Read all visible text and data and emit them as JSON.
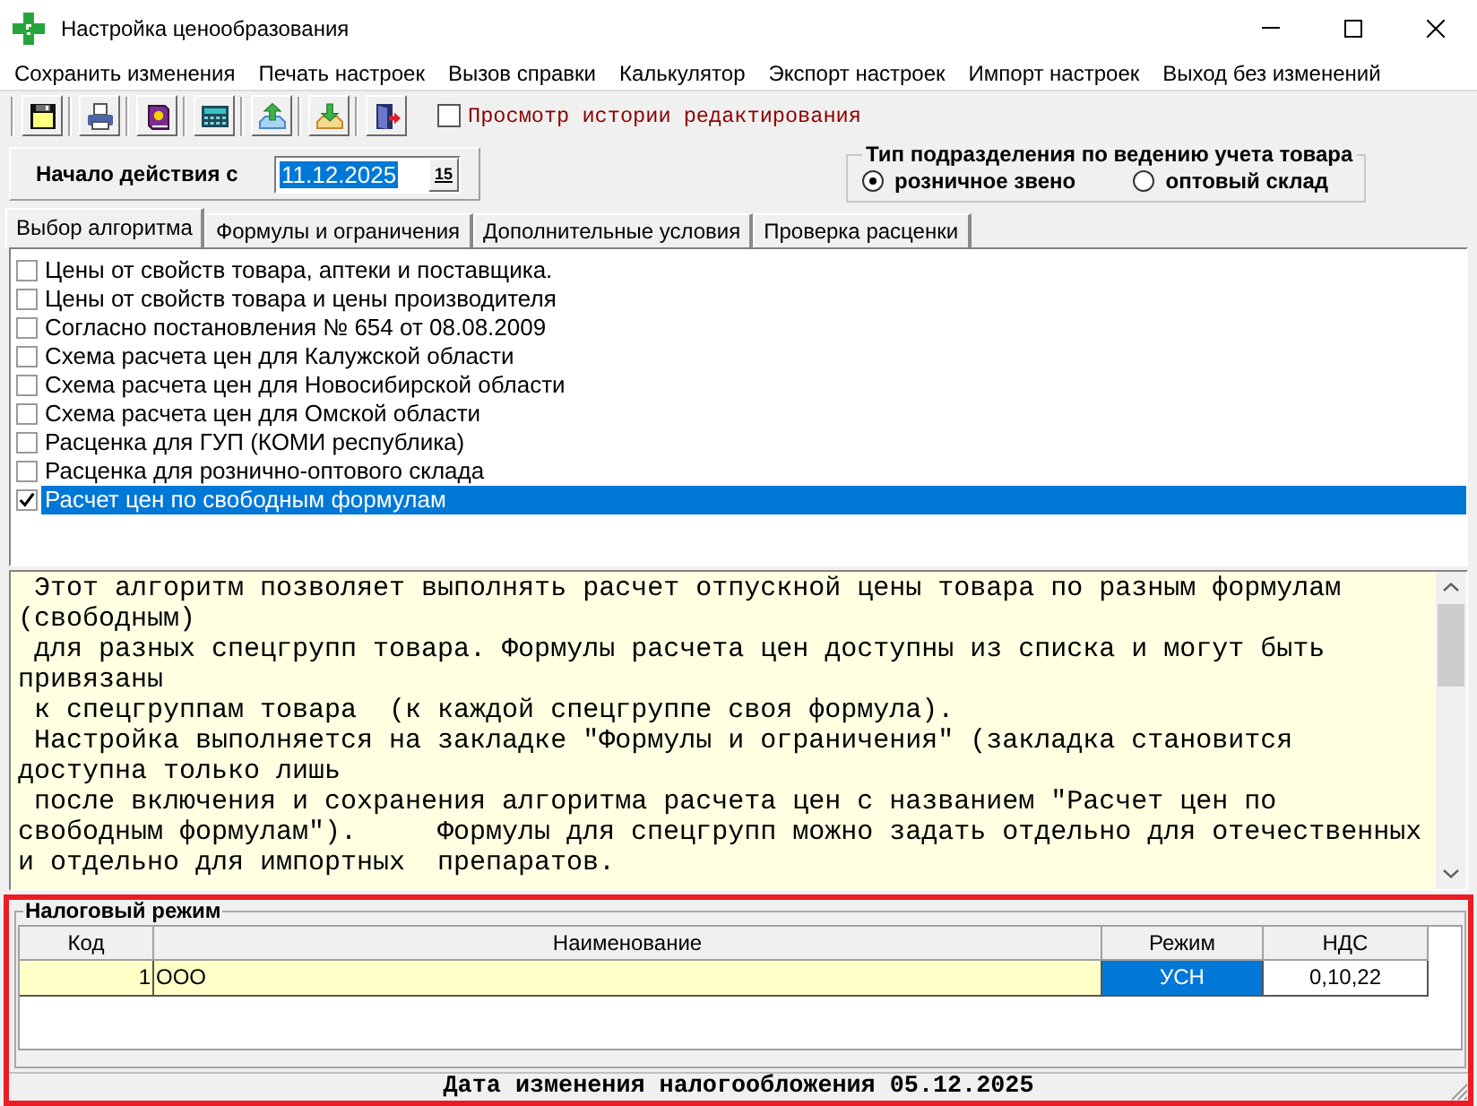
{
  "window": {
    "title": "Настройка ценообразования"
  },
  "menu": [
    "Сохранить изменения",
    "Печать настроек",
    "Вызов справки",
    "Калькулятор",
    "Экспорт настроек",
    "Импорт настроек",
    "Выход без изменений"
  ],
  "history_checkbox": {
    "label": "Просмотр истории редактирования",
    "checked": false
  },
  "start_date": {
    "label": "Начало действия с",
    "value": "11.12.2025",
    "highlighted": true,
    "calendar_button": "15"
  },
  "unit_type": {
    "title": "Тип подразделения по ведению учета товара",
    "options": [
      {
        "label": "розничное звено",
        "selected": true
      },
      {
        "label": "оптовый склад",
        "selected": false
      }
    ]
  },
  "tabs": [
    {
      "label": "Выбор алгоритма",
      "selected": true
    },
    {
      "label": "Формулы и ограничения",
      "selected": false
    },
    {
      "label": "Дополнительные условия",
      "selected": false
    },
    {
      "label": "Проверка расценки",
      "selected": false
    }
  ],
  "algorithms": [
    {
      "label": "Цены от свойств товара, аптеки и поставщика.",
      "checked": false,
      "selected": false
    },
    {
      "label": "Цены от свойств товара и цены производителя",
      "checked": false,
      "selected": false
    },
    {
      "label": "Согласно постановления № 654 от 08.08.2009",
      "checked": false,
      "selected": false
    },
    {
      "label": "Схема расчета цен для Калужской области",
      "checked": false,
      "selected": false
    },
    {
      "label": "Схема расчета цен для Новосибирской области",
      "checked": false,
      "selected": false
    },
    {
      "label": "Схема расчета цен для Омской области",
      "checked": false,
      "selected": false
    },
    {
      "label": "Расценка для ГУП (КОМИ республика)",
      "checked": false,
      "selected": false
    },
    {
      "label": "Расценка для рознично-оптового склада",
      "checked": false,
      "selected": false
    },
    {
      "label": "Расчет цен по свободным формулам",
      "checked": true,
      "selected": true
    }
  ],
  "description": [
    " Этот алгоритм позволяет выполнять расчет отпускной цены товара по разным формулам (свободным)",
    " для разных спецгрупп товара. Формулы расчета цен доступны из списка и могут быть привязаны",
    " к спецгруппам товара  (к каждой спецгруппе своя формула).",
    " Настройка выполняется на закладке \"Формулы и ограничения\" (закладка становится доступна только лишь",
    " после включения и сохранения алгоритма расчета цен с названием \"Расчет цен по свободным формулам\").     Формулы для спецгрупп можно задать отдельно для отечественных и отдельно для импортных  препаратов."
  ],
  "tax_regime": {
    "title": "Налоговый режим",
    "columns": [
      "Код",
      "Наименование",
      "Режим",
      "НДС"
    ],
    "rows": [
      {
        "cells": [
          {
            "text": "1",
            "selected": false,
            "shaded": true
          },
          {
            "text": "ООО",
            "selected": false,
            "shaded": true
          },
          {
            "text": "УСН",
            "selected": true
          },
          {
            "text": "0,10,22",
            "selected": false,
            "shaded": false
          }
        ]
      }
    ]
  },
  "status_bar": "Дата изменения налогообложения 05.12.2025"
}
